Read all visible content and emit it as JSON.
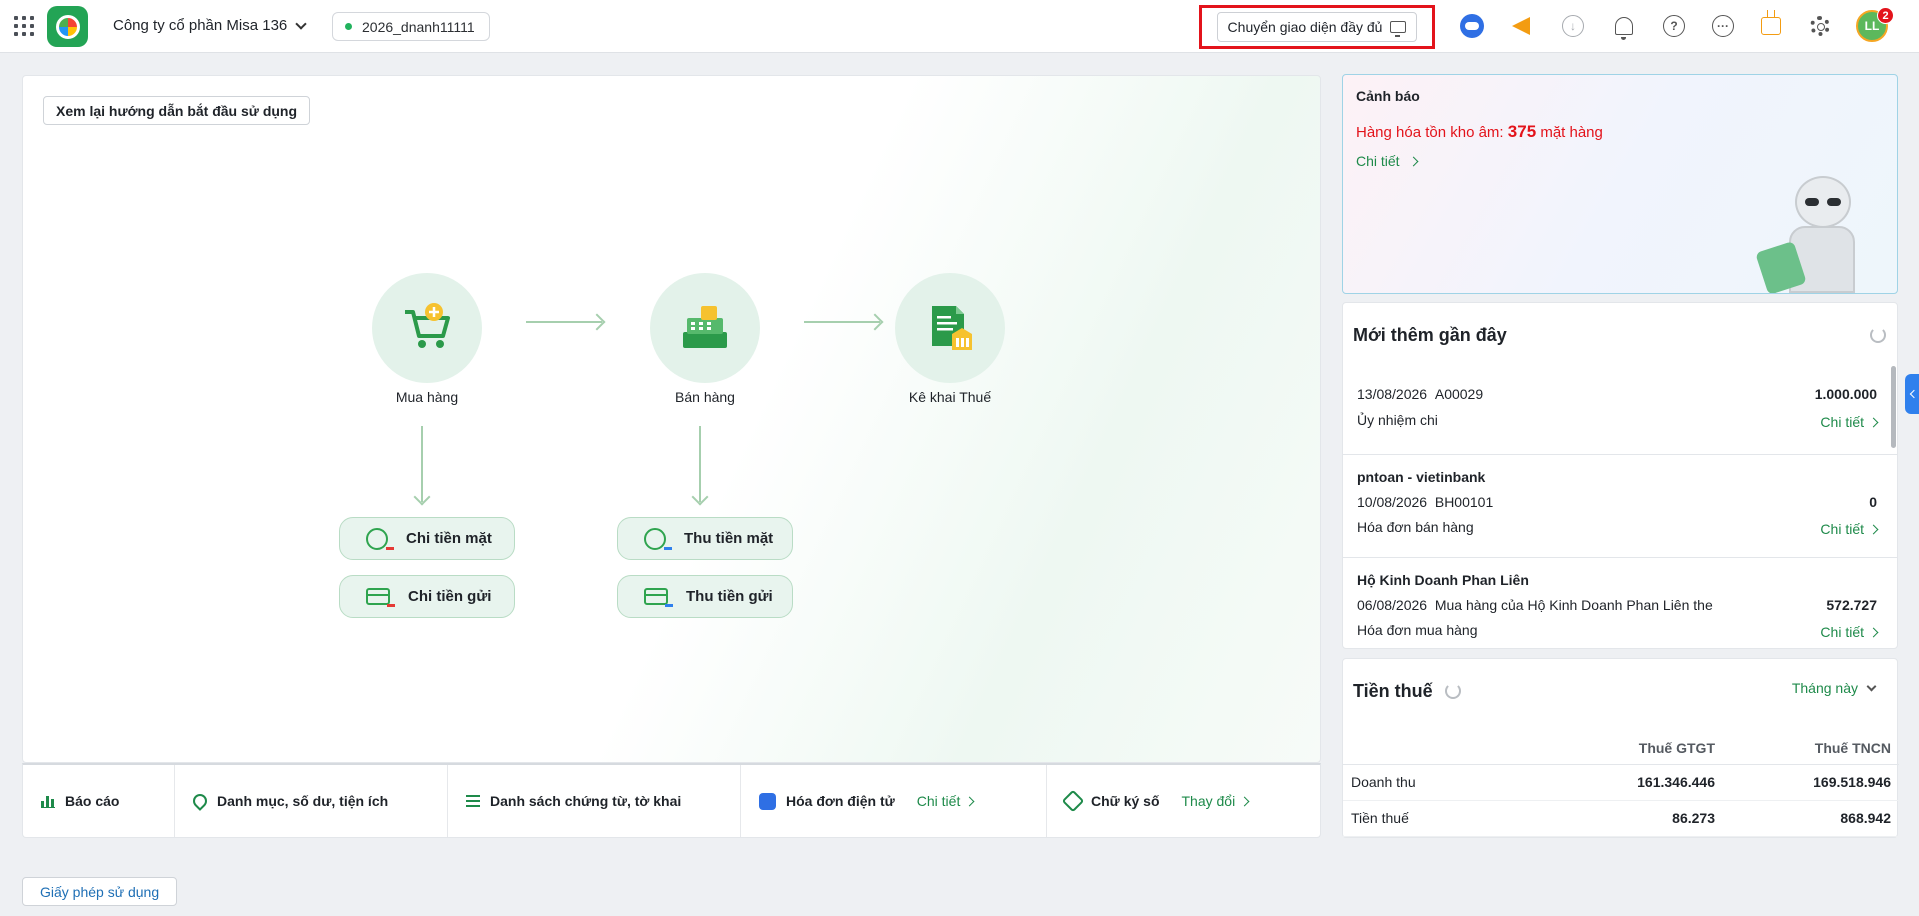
{
  "topbar": {
    "company_name": "Công ty cổ phần Misa 136",
    "database": "2026_dnanh11111",
    "switch_ui_label": "Chuyển giao diện đầy đủ",
    "avatar_initials": "LL",
    "notification_count": "2",
    "icons": [
      "apps-grid-icon",
      "ai-assistant-icon",
      "megaphone-icon",
      "download-icon",
      "bell-icon",
      "help-icon",
      "more-icon",
      "inbox-icon",
      "gear-icon"
    ]
  },
  "flow": {
    "guide_button": "Xem lại hướng dẫn bắt đầu sử dụng",
    "nodes": [
      {
        "label": "Mua hàng",
        "icon": "shopping-cart-icon"
      },
      {
        "label": "Bán hàng",
        "icon": "cash-register-icon"
      },
      {
        "label": "Kê khai Thuế",
        "icon": "tax-document-icon"
      }
    ],
    "actions": {
      "cash_payment": "Chi tiền mặt",
      "bank_payment": "Chi tiền gửi",
      "cash_receipt": "Thu tiền mặt",
      "bank_receipt": "Thu tiền gửi"
    }
  },
  "bottom_bar": {
    "reports": "Báo cáo",
    "catalog": "Danh mục, số dư, tiện ích",
    "documents": "Danh sách chứng từ, tờ khai",
    "einvoice": "Hóa đơn điện tử",
    "einvoice_link": "Chi tiết",
    "signature": "Chữ ký số",
    "signature_link": "Thay đổi"
  },
  "license_button": "Giấy phép sử dụng",
  "warning": {
    "title": "Cảnh báo",
    "message_prefix": "Hàng hóa tồn kho âm:",
    "count": "375",
    "message_suffix": "mặt hàng",
    "link": "Chi tiết"
  },
  "recent": {
    "title": "Mới thêm gần đây",
    "items": [
      {
        "name": "",
        "date": "13/08/2026",
        "code": "A00029",
        "desc": "",
        "amount": "1.000.000",
        "type": "Ủy nhiệm chi",
        "link": "Chi tiết"
      },
      {
        "name": "pntoan - vietinbank",
        "date": "10/08/2026",
        "code": "BH00101",
        "desc": "",
        "amount": "0",
        "type": "Hóa đơn bán hàng",
        "link": "Chi tiết"
      },
      {
        "name": "Hộ Kinh Doanh Phan Liên",
        "date": "06/08/2026",
        "code": "",
        "desc": "Mua hàng của Hộ Kinh Doanh Phan Liên the",
        "amount": "572.727",
        "type": "Hóa đơn mua hàng",
        "link": "Chi tiết"
      }
    ]
  },
  "tax": {
    "title": "Tiền thuế",
    "period": "Tháng này",
    "columns": [
      "",
      "Thuế GTGT",
      "Thuế TNCN"
    ],
    "rows": [
      {
        "label": "Doanh thu",
        "vat": "161.346.446",
        "pit": "169.518.946"
      },
      {
        "label": "Tiền thuế",
        "vat": "86.273",
        "pit": "868.942"
      }
    ]
  }
}
